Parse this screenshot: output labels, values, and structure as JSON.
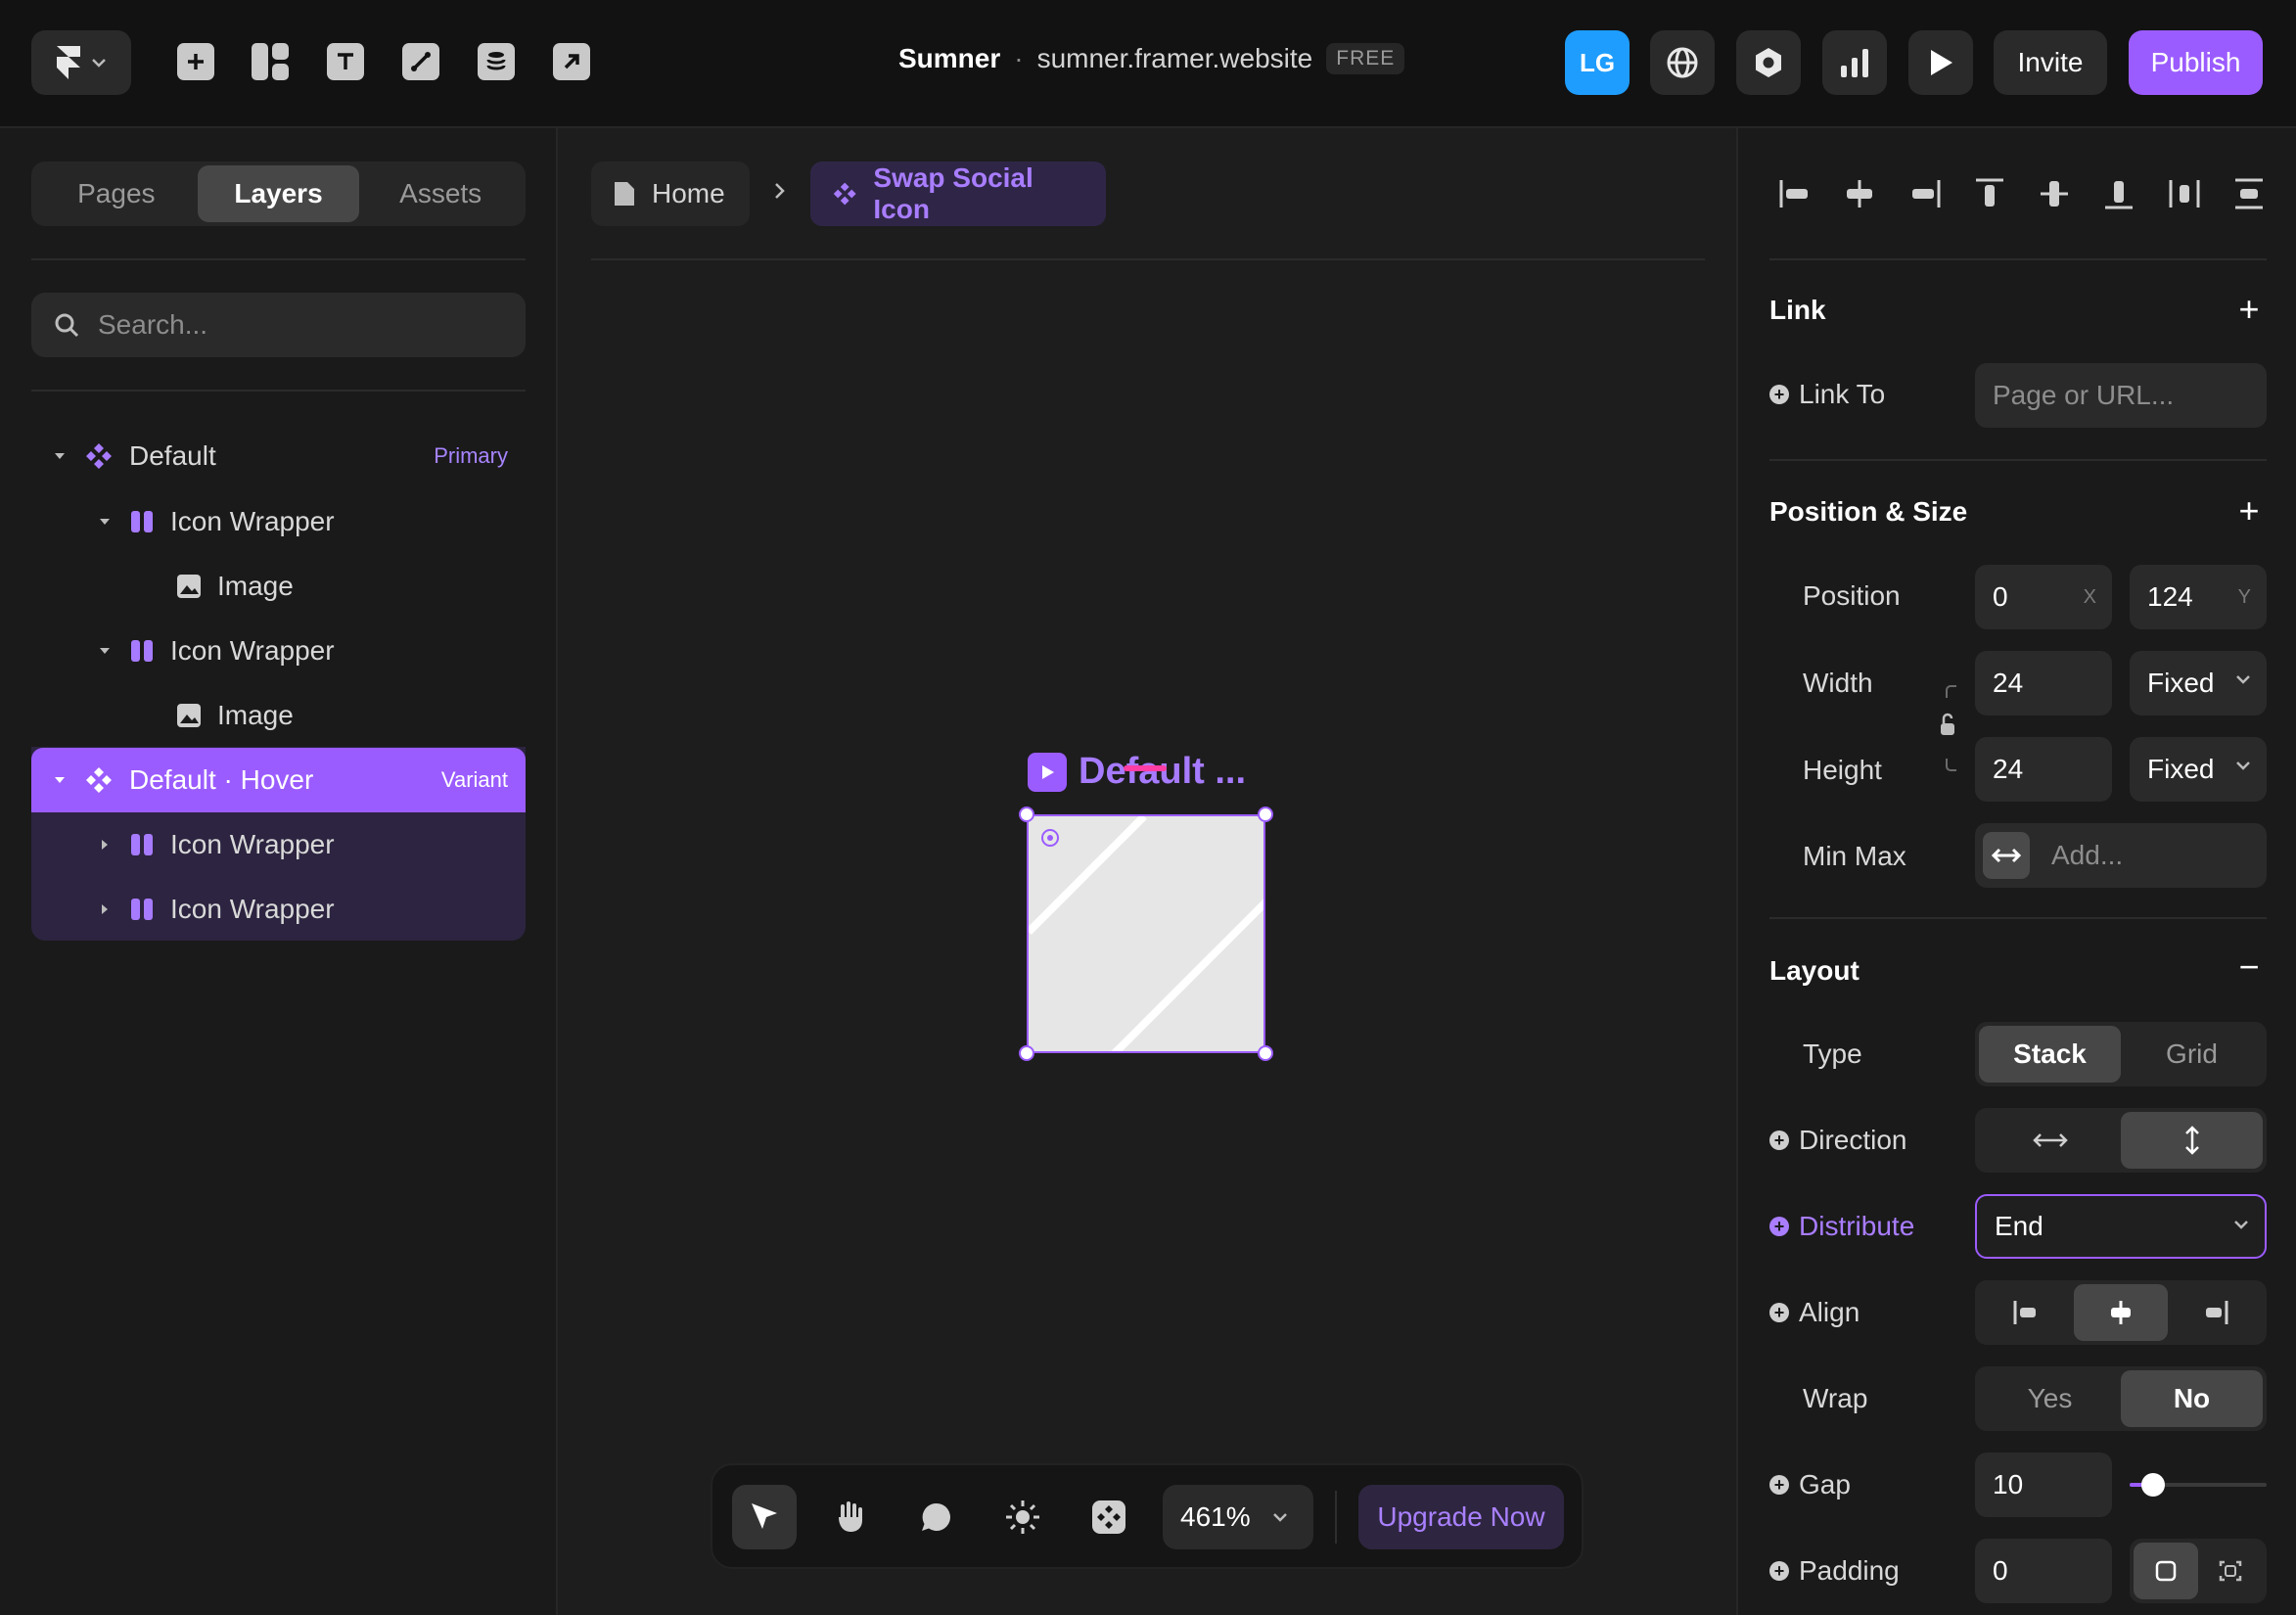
{
  "topbar": {
    "project_name": "Sumner",
    "separator": "·",
    "domain": "sumner.framer.website",
    "plan_badge": "FREE",
    "avatar_initials": "LG",
    "invite_label": "Invite",
    "publish_label": "Publish"
  },
  "left_panel": {
    "tabs": [
      "Pages",
      "Layers",
      "Assets"
    ],
    "active_tab": "Layers",
    "search_placeholder": "Search...",
    "layers": [
      {
        "label": "Default",
        "tag": "Primary"
      },
      {
        "label": "Icon Wrapper"
      },
      {
        "label": "Image"
      },
      {
        "label": "Icon Wrapper"
      },
      {
        "label": "Image"
      },
      {
        "label": "Default · Hover",
        "tag": "Variant"
      },
      {
        "label": "Icon Wrapper"
      },
      {
        "label": "Icon Wrapper"
      }
    ]
  },
  "canvas": {
    "breadcrumb_home": "Home",
    "breadcrumb_component": "Swap Social Icon",
    "frame_label": "Default ...",
    "zoom": "461%",
    "upgrade_label": "Upgrade Now"
  },
  "right_panel": {
    "link": {
      "title": "Link",
      "link_to_label": "Link To",
      "link_to_placeholder": "Page or URL..."
    },
    "position_size": {
      "title": "Position & Size",
      "position_label": "Position",
      "x_value": "0",
      "x_axis": "X",
      "y_value": "124",
      "y_axis": "Y",
      "width_label": "Width",
      "width_value": "24",
      "width_mode": "Fixed",
      "height_label": "Height",
      "height_value": "24",
      "height_mode": "Fixed",
      "minmax_label": "Min Max",
      "minmax_placeholder": "Add..."
    },
    "layout": {
      "title": "Layout",
      "type_label": "Type",
      "type_options": [
        "Stack",
        "Grid"
      ],
      "type_selected": "Stack",
      "direction_label": "Direction",
      "distribute_label": "Distribute",
      "distribute_value": "End",
      "align_label": "Align",
      "wrap_label": "Wrap",
      "wrap_options": [
        "Yes",
        "No"
      ],
      "wrap_selected": "No",
      "gap_label": "Gap",
      "gap_value": "10",
      "padding_label": "Padding",
      "padding_value": "0"
    }
  },
  "colors": {
    "accent": "#9b5cff",
    "avatar": "#1e9dff",
    "selection_pink": "#ff3da5"
  }
}
